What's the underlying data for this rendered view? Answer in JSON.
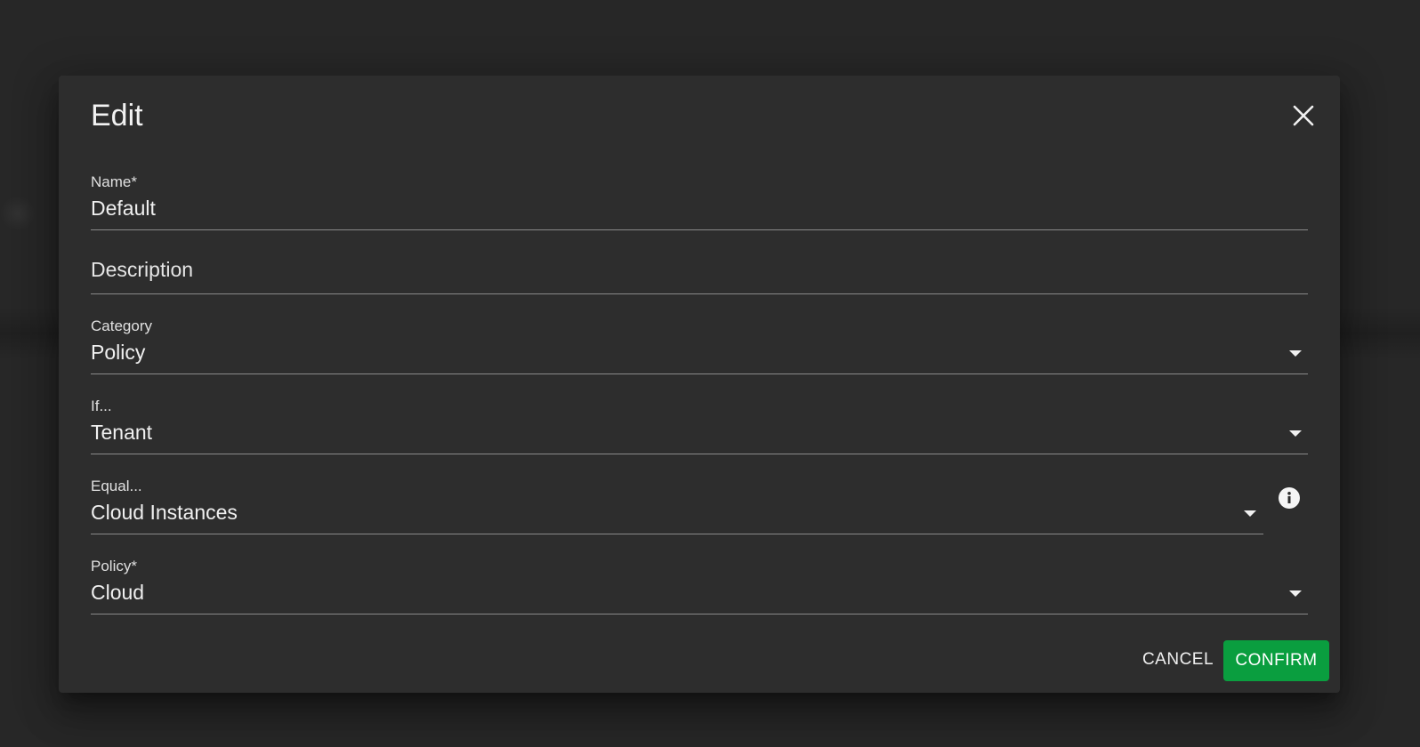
{
  "dialog": {
    "title": "Edit",
    "close_icon": "close-icon"
  },
  "fields": {
    "name": {
      "label": "Name*",
      "value": "Default"
    },
    "description": {
      "placeholder": "Description",
      "value": ""
    },
    "category": {
      "label": "Category",
      "value": "Policy"
    },
    "if": {
      "label": "If...",
      "value": "Tenant"
    },
    "equal": {
      "label": "Equal...",
      "value": "Cloud Instances",
      "info_icon": "info-icon"
    },
    "policy": {
      "label": "Policy*",
      "value": "Cloud"
    }
  },
  "actions": {
    "cancel_label": "CANCEL",
    "confirm_label": "CONFIRM"
  },
  "colors": {
    "background": "#262626",
    "dialog": "#2d2d2d",
    "confirm": "#0a9e3f",
    "text": "#f0f0f0"
  }
}
